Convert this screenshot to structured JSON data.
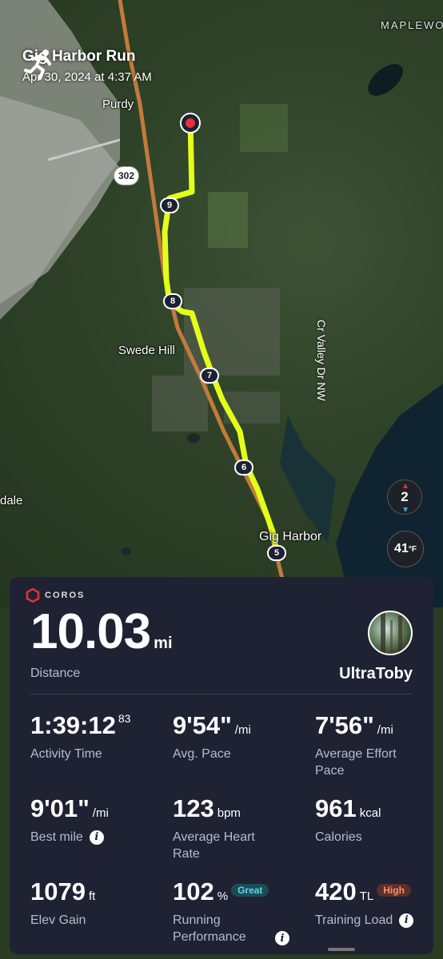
{
  "activity": {
    "title": "Gig Harbor Run",
    "datetime": "Apr 30, 2024 at 4:37 AM",
    "type_icon": "running-person-icon"
  },
  "map": {
    "labels": {
      "maplewood": "MAPLEWOO",
      "purdy": "Purdy",
      "route_302": "302",
      "swede_hill": "Swede Hill",
      "valley_dr": "Cr Valley Dr NW",
      "dale": "dale",
      "gig_harbor": "Gig Harbor"
    },
    "mile_markers": [
      "9",
      "8",
      "7",
      "6",
      "5"
    ],
    "route_color": "#e4ff1a",
    "compass": {
      "value": "2",
      "icon": "compass-icon"
    },
    "weather": {
      "temp": "41",
      "unit": "°F"
    }
  },
  "card": {
    "brand": "COROS",
    "distance": {
      "value": "10.03",
      "unit": "mi",
      "label": "Distance"
    },
    "username": "UltraToby",
    "stats": [
      {
        "value": "1:39:12",
        "sup": "83",
        "unit": "",
        "label": "Activity Time"
      },
      {
        "value": "9'54\"",
        "unit": "/mi",
        "label": "Avg. Pace"
      },
      {
        "value": "7'56\"",
        "unit": "/mi",
        "label": "Average Effort Pace"
      },
      {
        "value": "9'01\"",
        "unit": "/mi",
        "label": "Best mile"
      },
      {
        "value": "123",
        "unit": "bpm",
        "label": "Average Heart Rate"
      },
      {
        "value": "961",
        "unit": "kcal",
        "label": "Calories"
      },
      {
        "value": "1079",
        "unit": "ft",
        "label": "Elev Gain"
      },
      {
        "value": "102",
        "unit": "%",
        "badge": "Great",
        "label": "Running Performance"
      },
      {
        "value": "420",
        "unit": "TL",
        "badge": "High",
        "label": "Training Load"
      }
    ]
  }
}
